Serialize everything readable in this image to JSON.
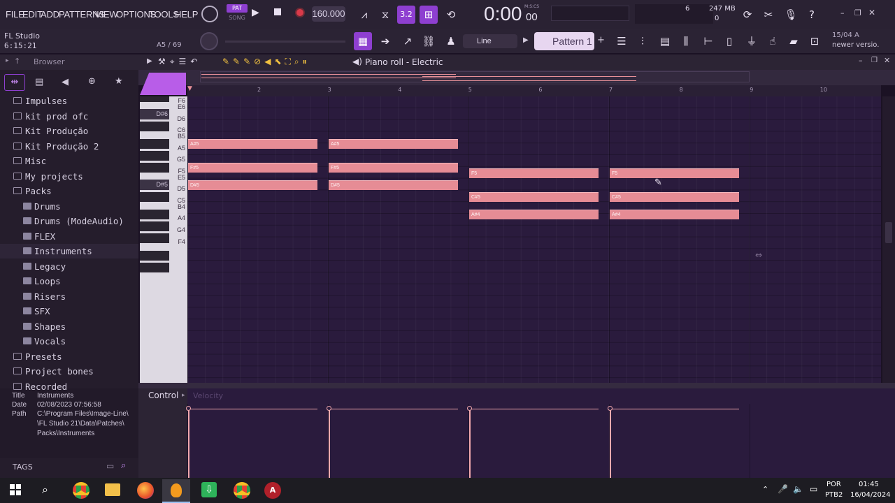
{
  "menu": [
    "FILE",
    "EDIT",
    "ADD",
    "PATTERNS",
    "VIEW",
    "OPTIONS",
    "TOOLS",
    "HELP"
  ],
  "transport": {
    "pat_label": "PAT",
    "song_label": "SONG",
    "tempo": "160.000",
    "time": "0:00",
    "time_small": "00",
    "time_unit": "M:S:CS",
    "cpu_num": "6",
    "memory": "247 MB",
    "voices": "0"
  },
  "app": {
    "name": "FL Studio",
    "time": "6:15:21",
    "note_pos": "A5 / 69"
  },
  "toolbar2": {
    "snap": "Line",
    "pattern": "Pattern 1",
    "news_date": "15/04",
    "news_letter": "A",
    "news_text": "newer versio."
  },
  "browser": {
    "title": "Browser",
    "items": [
      {
        "label": "Impulses",
        "sub": false
      },
      {
        "label": "kit prod ofc",
        "sub": false
      },
      {
        "label": "Kit Produção",
        "sub": false
      },
      {
        "label": "Kit Produção 2",
        "sub": false
      },
      {
        "label": "Misc",
        "sub": false
      },
      {
        "label": "My projects",
        "sub": false
      },
      {
        "label": "Packs",
        "sub": false,
        "open": true
      },
      {
        "label": "Drums",
        "sub": true
      },
      {
        "label": "Drums (ModeAudio)",
        "sub": true
      },
      {
        "label": "FLEX",
        "sub": true
      },
      {
        "label": "Instruments",
        "sub": true,
        "selected": true
      },
      {
        "label": "Legacy",
        "sub": true
      },
      {
        "label": "Loops",
        "sub": true
      },
      {
        "label": "Risers",
        "sub": true
      },
      {
        "label": "SFX",
        "sub": true
      },
      {
        "label": "Shapes",
        "sub": true
      },
      {
        "label": "Vocals",
        "sub": true
      },
      {
        "label": "Presets",
        "sub": false
      },
      {
        "label": "Project bones",
        "sub": false
      },
      {
        "label": "Recorded",
        "sub": false
      }
    ],
    "info": {
      "title_k": "Title",
      "title_v": "Instruments",
      "date_k": "Date",
      "date_v": "02/08/2023 07:56:58",
      "path_k": "Path",
      "path_v1": "C:\\Program Files\\Image-Line\\",
      "path_v2": "\\FL Studio 21\\Data\\Patches\\",
      "path_v3": "Packs\\Instruments"
    },
    "tags": "TAGS"
  },
  "piano_roll": {
    "title": "Piano roll - Electric",
    "ruler": [
      "2",
      "3",
      "4",
      "5",
      "6",
      "7",
      "8",
      "9",
      "10"
    ],
    "key_labels": [
      "F6",
      "E6",
      "D#6",
      "D6",
      "C6",
      "B5",
      "A5",
      "G5",
      "F5",
      "E5",
      "D#5",
      "D5",
      "C5",
      "B4",
      "A4",
      "G4",
      "F4"
    ],
    "notes": [
      {
        "label": "A#5",
        "bar": 1,
        "len": 0.92,
        "row": "A#5"
      },
      {
        "label": "A#5",
        "bar": 2,
        "len": 0.92,
        "row": "A#5"
      },
      {
        "label": "F#5",
        "bar": 1,
        "len": 0.92,
        "row": "F#5"
      },
      {
        "label": "F#5",
        "bar": 2,
        "len": 0.92,
        "row": "F#5"
      },
      {
        "label": "D#5",
        "bar": 1,
        "len": 0.92,
        "row": "D#5"
      },
      {
        "label": "D#5",
        "bar": 2,
        "len": 0.92,
        "row": "D#5"
      },
      {
        "label": "F5",
        "bar": 3,
        "len": 0.92,
        "row": "F5"
      },
      {
        "label": "F5",
        "bar": 4,
        "len": 0.92,
        "row": "F5"
      },
      {
        "label": "C#5",
        "bar": 3,
        "len": 0.92,
        "row": "C#5"
      },
      {
        "label": "C#5",
        "bar": 4,
        "len": 0.92,
        "row": "C#5"
      },
      {
        "label": "A#4",
        "bar": 3,
        "len": 0.92,
        "row": "A#4"
      },
      {
        "label": "A#4",
        "bar": 4,
        "len": 0.92,
        "row": "A#4"
      }
    ],
    "control_label": "Control",
    "control_param": "Velocity"
  },
  "taskbar": {
    "lang": "POR",
    "kbd": "PTB2",
    "time": "01:45",
    "date": "16/04/2024"
  },
  "colors": {
    "note": "#e68c95",
    "accent": "#8e3fd0",
    "grid": "#2a1b3d"
  }
}
